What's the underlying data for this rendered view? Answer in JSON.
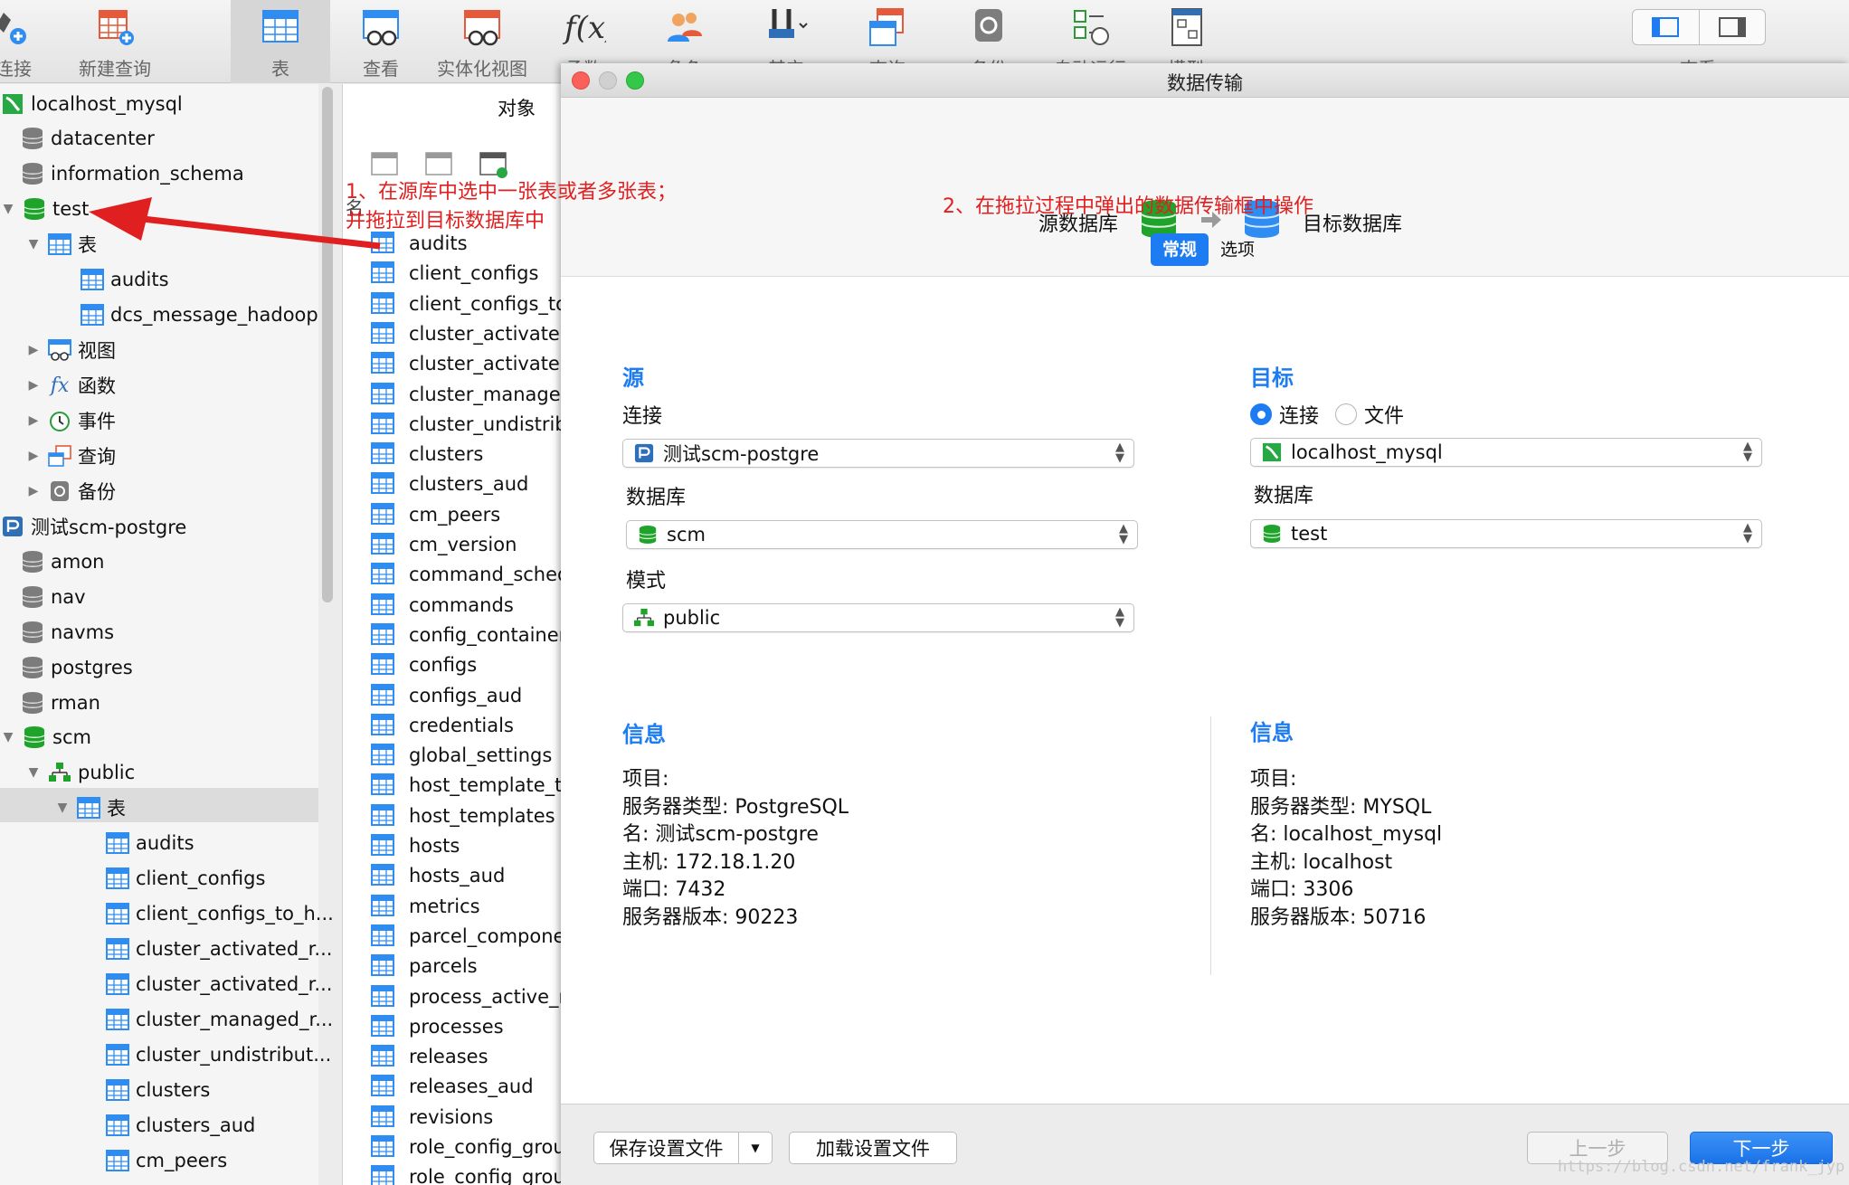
{
  "toolbar": {
    "buttons": [
      {
        "label": "连接",
        "icon": "connect-icon"
      },
      {
        "label": "新建查询",
        "icon": "new-query-icon"
      },
      {
        "label": "表",
        "icon": "table-icon"
      },
      {
        "label": "查看",
        "icon": "view-icon"
      },
      {
        "label": "实体化视图",
        "icon": "materialized-view-icon"
      },
      {
        "label": "函数",
        "icon": "function-icon"
      },
      {
        "label": "角色",
        "icon": "role-icon"
      },
      {
        "label": "其它",
        "icon": "tools-icon"
      },
      {
        "label": "查询",
        "icon": "query-icon"
      },
      {
        "label": "备份",
        "icon": "backup-icon"
      },
      {
        "label": "自动运行",
        "icon": "automation-icon"
      },
      {
        "label": "模型",
        "icon": "model-icon"
      },
      {
        "label": "查看",
        "icon": "view-mode-icon"
      }
    ]
  },
  "tree": {
    "connections": [
      {
        "name": "localhost_mysql",
        "databases": [
          "datacenter",
          "information_schema"
        ]
      },
      {
        "name": "测试scm-postgre",
        "databases": [
          "amon",
          "nav",
          "navms",
          "postgres",
          "rman"
        ]
      }
    ],
    "test_db": "test",
    "test_tables_label": "表",
    "test_tables": [
      "audits",
      "dcs_message_hadoop"
    ],
    "test_folders": [
      "视图",
      "函数",
      "事件",
      "查询",
      "备份"
    ],
    "scm_db": "scm",
    "scm_schema": "public",
    "scm_tables_label": "表",
    "scm_tables": [
      "audits",
      "client_configs",
      "client_configs_to_h...",
      "cluster_activated_r...",
      "cluster_activated_r...",
      "cluster_managed_r...",
      "cluster_undistribut...",
      "clusters",
      "clusters_aud",
      "cm_peers"
    ]
  },
  "objects": {
    "title": "对象",
    "list_header": "名",
    "items": [
      "audits",
      "client_configs",
      "client_configs_to",
      "cluster_activated",
      "cluster_activated",
      "cluster_managed",
      "cluster_undistrib",
      "clusters",
      "clusters_aud",
      "cm_peers",
      "cm_version",
      "command_sched",
      "commands",
      "config_container",
      "configs",
      "configs_aud",
      "credentials",
      "global_settings",
      "host_template_to",
      "host_templates",
      "hosts",
      "hosts_aud",
      "metrics",
      "parcel_component",
      "parcels",
      "process_active_r",
      "processes",
      "releases",
      "releases_aud",
      "revisions",
      "role_config_grou",
      "role_config_grou"
    ]
  },
  "dialog": {
    "title": "数据传输",
    "flow": {
      "source": "源数据库",
      "target": "目标数据库"
    },
    "tabs": [
      "常规",
      "选项"
    ],
    "source": {
      "title": "源",
      "connection_label": "连接",
      "connection_value": "测试scm-postgre",
      "database_label": "数据库",
      "database_value": "scm",
      "schema_label": "模式",
      "schema_value": "public"
    },
    "target": {
      "title": "目标",
      "radio_connection": "连接",
      "radio_file": "文件",
      "connection_value": "localhost_mysql",
      "database_label": "数据库",
      "database_value": "test"
    },
    "source_info": {
      "title": "信息",
      "lines": [
        "项目:",
        "服务器类型: PostgreSQL",
        "名: 测试scm-postgre",
        "主机: 172.18.1.20",
        "端口: 7432",
        "服务器版本: 90223"
      ]
    },
    "target_info": {
      "title": "信息",
      "lines": [
        "项目:",
        "服务器类型: MYSQL",
        "名: localhost_mysql",
        "主机: localhost",
        "端口: 3306",
        "服务器版本: 50716"
      ]
    },
    "footer": {
      "save_settings": "保存设置文件",
      "load_settings": "加载设置文件",
      "prev": "上一步",
      "next": "下一步"
    }
  },
  "annotations": {
    "step1_line1": "1、在源库中选中一张表或者多张表；",
    "step1_line2": "并拖拉到目标数据库中",
    "step2": "2、在拖拉过程中弹出的数据传输框中操作"
  },
  "watermark": "https://blog.csdn.net/frank_jyp",
  "colors": {
    "accent": "#1d7cf2",
    "annotation": "#e02020",
    "db_green": "#1fa32b",
    "db_blue": "#2f8df2"
  }
}
